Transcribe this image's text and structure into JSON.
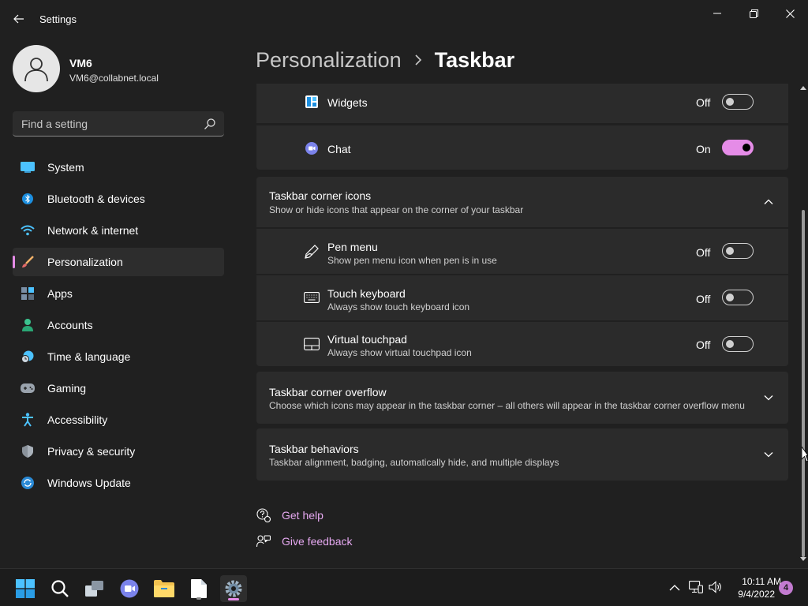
{
  "window": {
    "title": "Settings"
  },
  "profile": {
    "name": "VM6",
    "email": "VM6@collabnet.local"
  },
  "search": {
    "placeholder": "Find a setting"
  },
  "sidebar": {
    "items": [
      {
        "label": "System",
        "icon": "monitor-icon",
        "selected": false
      },
      {
        "label": "Bluetooth & devices",
        "icon": "bluetooth-icon",
        "selected": false
      },
      {
        "label": "Network & internet",
        "icon": "wifi-icon",
        "selected": false
      },
      {
        "label": "Personalization",
        "icon": "brush-icon",
        "selected": true
      },
      {
        "label": "Apps",
        "icon": "apps-icon",
        "selected": false
      },
      {
        "label": "Accounts",
        "icon": "person-icon",
        "selected": false
      },
      {
        "label": "Time & language",
        "icon": "clock-globe-icon",
        "selected": false
      },
      {
        "label": "Gaming",
        "icon": "gamepad-icon",
        "selected": false
      },
      {
        "label": "Accessibility",
        "icon": "accessibility-icon",
        "selected": false
      },
      {
        "label": "Privacy & security",
        "icon": "shield-icon",
        "selected": false
      },
      {
        "label": "Windows Update",
        "icon": "refresh-icon",
        "selected": false
      }
    ]
  },
  "header": {
    "parent": "Personalization",
    "current": "Taskbar"
  },
  "taskbar_items": {
    "widgets": {
      "label": "Widgets",
      "state": "Off",
      "on": false
    },
    "chat": {
      "label": "Chat",
      "state": "On",
      "on": true
    }
  },
  "corner_icons": {
    "title": "Taskbar corner icons",
    "subtitle": "Show or hide icons that appear on the corner of your taskbar",
    "expanded": true,
    "items": [
      {
        "title": "Pen menu",
        "subtitle": "Show pen menu icon when pen is in use",
        "state": "Off",
        "on": false
      },
      {
        "title": "Touch keyboard",
        "subtitle": "Always show touch keyboard icon",
        "state": "Off",
        "on": false
      },
      {
        "title": "Virtual touchpad",
        "subtitle": "Always show virtual touchpad icon",
        "state": "Off",
        "on": false
      }
    ]
  },
  "corner_overflow": {
    "title": "Taskbar corner overflow",
    "subtitle": "Choose which icons may appear in the taskbar corner – all others will appear in the taskbar corner overflow menu"
  },
  "behaviors": {
    "title": "Taskbar behaviors",
    "subtitle": "Taskbar alignment, badging, automatically hide, and multiple displays"
  },
  "links": {
    "help": "Get help",
    "feedback": "Give feedback"
  },
  "os_taskbar": {
    "time": "10:11 AM",
    "date": "9/4/2022",
    "notifications": "4"
  },
  "colors": {
    "accent": "#e58ce7",
    "background": "#202020",
    "card": "#2b2b2b",
    "link": "#e5a8f0"
  }
}
